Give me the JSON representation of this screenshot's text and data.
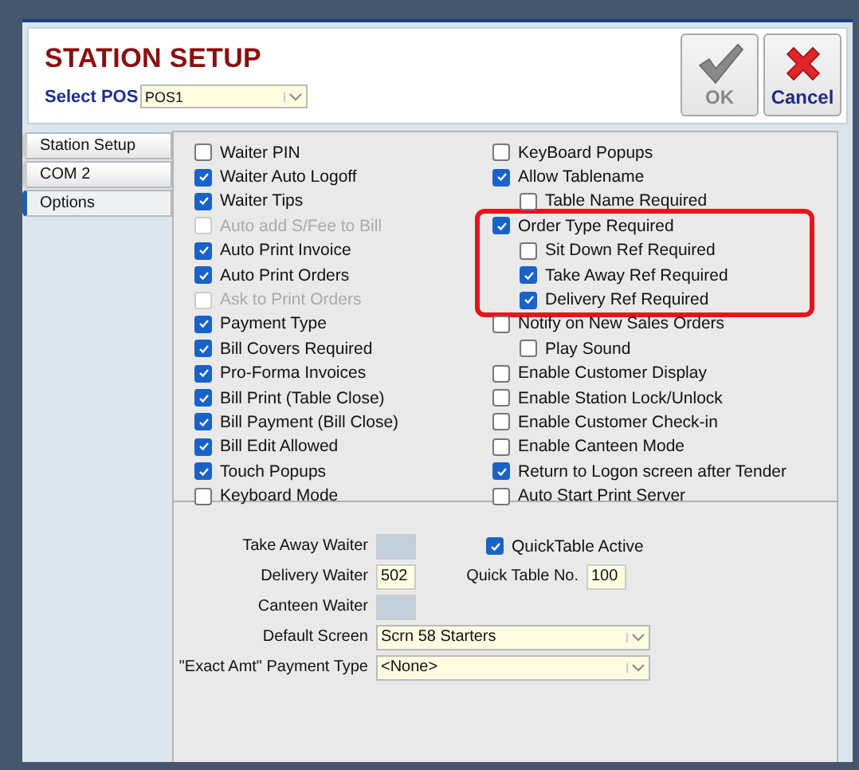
{
  "header": {
    "title": "STATION SETUP",
    "select_pos": {
      "label": "Select POS",
      "value": "POS1"
    },
    "buttons": [
      {
        "kind": "ok",
        "label": "OK",
        "disabled": true
      },
      {
        "kind": "cancel",
        "label": "Cancel",
        "disabled": false
      }
    ]
  },
  "tabs": [
    {
      "label": "Station Setup",
      "selected": false
    },
    {
      "label": "COM 2",
      "selected": false
    },
    {
      "label": "Options",
      "selected": true
    }
  ],
  "options_left": [
    {
      "label": "Waiter  PIN",
      "checked": false,
      "disabled": false
    },
    {
      "label": "Waiter Auto Logoff",
      "checked": true,
      "disabled": false
    },
    {
      "label": "Waiter Tips",
      "checked": true,
      "disabled": false
    },
    {
      "label": "Auto add S/Fee to Bill",
      "checked": false,
      "disabled": true
    },
    {
      "label": "Auto Print Invoice",
      "checked": true,
      "disabled": false
    },
    {
      "label": "Auto Print Orders",
      "checked": true,
      "disabled": false
    },
    {
      "label": "Ask to Print Orders",
      "checked": false,
      "disabled": true
    },
    {
      "label": "Payment Type",
      "checked": true,
      "disabled": false
    },
    {
      "label": "Bill Covers Required",
      "checked": true,
      "disabled": false
    },
    {
      "label": "Pro-Forma Invoices",
      "checked": true,
      "disabled": false
    },
    {
      "label": "Bill Print (Table Close)",
      "checked": true,
      "disabled": false
    },
    {
      "label": "Bill Payment (Bill Close)",
      "checked": true,
      "disabled": false
    },
    {
      "label": "Bill Edit Allowed",
      "checked": true,
      "disabled": false
    },
    {
      "label": "Touch Popups",
      "checked": true,
      "disabled": false
    },
    {
      "label": "Keyboard Mode",
      "checked": false,
      "disabled": false
    }
  ],
  "options_right": [
    {
      "label": "KeyBoard Popups",
      "checked": false,
      "highlighted": false
    },
    {
      "label": "Allow Tablename",
      "checked": true,
      "highlighted": false,
      "children": [
        {
          "label": "Table Name Required",
          "checked": false
        }
      ]
    },
    {
      "label": "Order Type Required",
      "checked": true,
      "highlighted": true,
      "children": [
        {
          "label": "Sit Down Ref Required",
          "checked": false
        },
        {
          "label": "Take Away Ref Required",
          "checked": true
        },
        {
          "label": "Delivery Ref Required",
          "checked": true
        }
      ]
    },
    {
      "label": "Notify on New Sales Orders",
      "checked": false,
      "highlighted": false,
      "children": [
        {
          "label": "Play Sound",
          "checked": false
        }
      ]
    },
    {
      "label": "Enable Customer Display",
      "checked": false,
      "highlighted": false
    },
    {
      "label": "Enable Station Lock/Unlock",
      "checked": false,
      "highlighted": false
    },
    {
      "label": "Enable Customer Check-in",
      "checked": false,
      "highlighted": false
    },
    {
      "label": "Enable Canteen Mode",
      "checked": false,
      "highlighted": false
    },
    {
      "label": "Return to Logon screen after Tender",
      "checked": true,
      "highlighted": false
    },
    {
      "label": "Auto Start Print Server",
      "checked": false,
      "highlighted": false
    }
  ],
  "waiters": [
    {
      "label": "Take Away Waiter",
      "disabled": true
    },
    {
      "label": "Delivery Waiter",
      "value": "502",
      "disabled": false
    },
    {
      "label": "Canteen Waiter",
      "disabled": true
    }
  ],
  "quick_table": {
    "active": {
      "label": "QuickTable Active",
      "checked": true
    },
    "number": {
      "label": "Quick Table No.",
      "value": "100"
    }
  },
  "dropdowns": [
    {
      "label": "Default Screen",
      "value": "Scrn 58 Starters"
    },
    {
      "label": "\"Exact Amt\" Payment Type",
      "value": "<None>"
    }
  ]
}
